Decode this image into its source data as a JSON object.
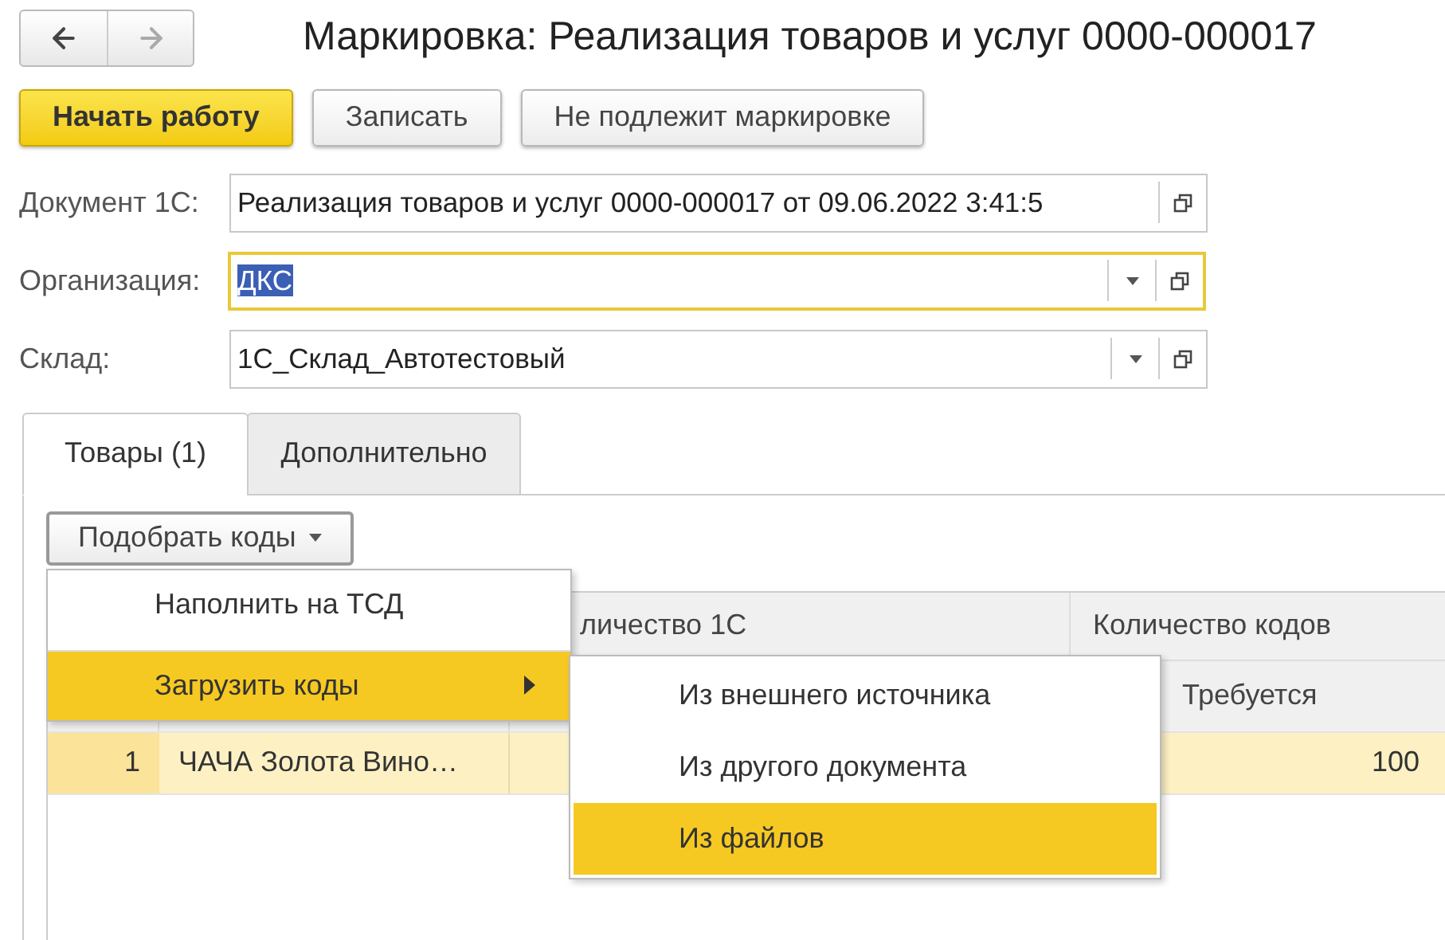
{
  "window": {
    "title": "Маркировка: Реализация товаров и услуг 0000-000017"
  },
  "nav": [
    {
      "kind": "back",
      "disabled": false
    },
    {
      "kind": "forward",
      "disabled": true
    }
  ],
  "buttons": [
    {
      "label": "Начать работу",
      "default": true
    },
    {
      "label": "Записать",
      "default": false
    },
    {
      "label": "Не подлежит маркировке",
      "default": false
    }
  ],
  "fields": [
    {
      "label": "Документ 1С:",
      "value": "Реализация товаров и услуг 0000-000017 от 09.06.2022 3:41:5",
      "dropdown": false,
      "focused": false
    },
    {
      "label": "Организация:",
      "value": "ДКС",
      "dropdown": true,
      "focused": true
    },
    {
      "label": "Склад:",
      "value": "1С_Склад_Автотестовый",
      "dropdown": true,
      "focused": false
    }
  ],
  "tabs": [
    {
      "label": "Товары (1)",
      "selected": true
    },
    {
      "label": "Дополнительно",
      "selected": false
    }
  ],
  "pick_button": {
    "label": "Подобрать коды"
  },
  "table": {
    "columns": [
      {
        "label": "личество 1С"
      },
      {
        "label": "Количество кодов",
        "sublabel": "Требуется"
      }
    ],
    "rows": [
      {
        "number": "1",
        "name": "ЧАЧА Золота Вино…",
        "required": "100",
        "selected": true
      }
    ]
  },
  "menu": {
    "items": [
      {
        "label": "Наполнить на ТСД",
        "selected": false,
        "submenu": false
      },
      {
        "label": "Загрузить коды",
        "selected": true,
        "submenu": true
      }
    ],
    "submenu": [
      {
        "label": "Из внешнего источника",
        "selected": false
      },
      {
        "label": "Из другого документа",
        "selected": false
      },
      {
        "label": "Из файлов",
        "selected": true
      }
    ]
  }
}
